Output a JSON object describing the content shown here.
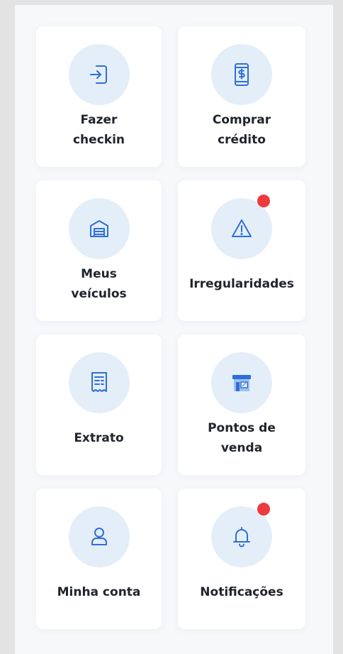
{
  "colors": {
    "icon_stroke": "#2f6fd6",
    "icon_bg": "#e4eef9",
    "badge": "#ee3a3f"
  },
  "tiles": [
    {
      "label": "Fazer\ncheckin",
      "icon": "checkin-icon",
      "badge": false
    },
    {
      "label": "Comprar\ncrédito",
      "icon": "dollar-phone-icon",
      "badge": false
    },
    {
      "label": "Meus\nveículos",
      "icon": "garage-icon",
      "badge": false
    },
    {
      "label": "Irregularidades",
      "icon": "warning-icon",
      "badge": true
    },
    {
      "label": "Extrato",
      "icon": "receipt-icon",
      "badge": false
    },
    {
      "label": "Pontos de\nvenda",
      "icon": "store-icon",
      "badge": false
    },
    {
      "label": "Minha conta",
      "icon": "user-icon",
      "badge": false
    },
    {
      "label": "Notificações",
      "icon": "bell-icon",
      "badge": true
    }
  ]
}
